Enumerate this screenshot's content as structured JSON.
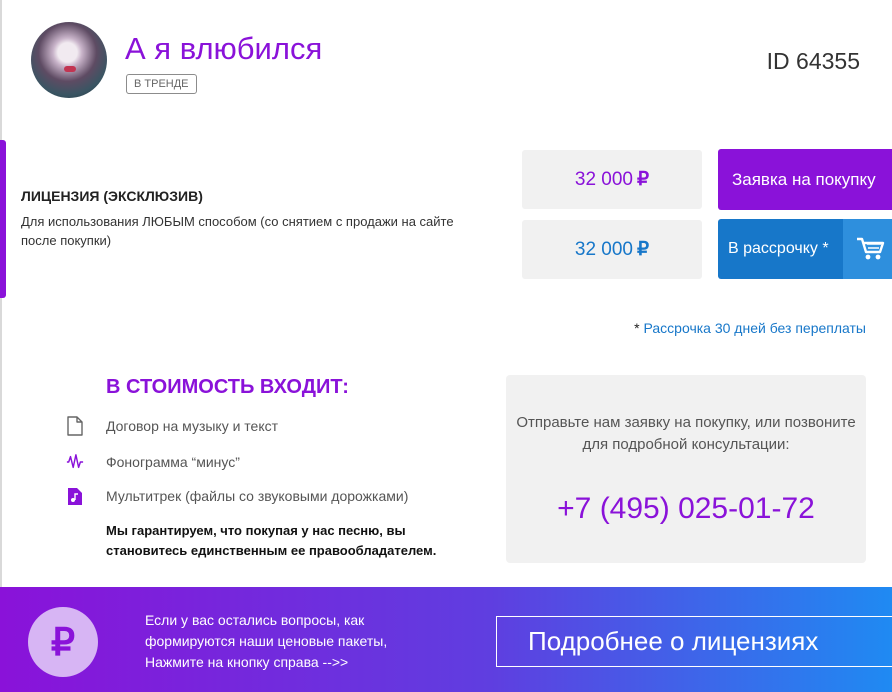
{
  "header": {
    "title": "А я влюбился",
    "badge": "В ТРЕНДЕ",
    "id_label": "ID 64355"
  },
  "license": {
    "title": "ЛИЦЕНЗИЯ (ЭКСКЛЮЗИВ)",
    "description": "Для использования ЛЮБЫМ способом (со снятием с продажи на сайте после покупки)",
    "price_full": "32 000",
    "price_installment": "32 000",
    "currency_symbol": "₽",
    "buy_button": "Заявка на покупку",
    "installment_button": "В рассрочку *",
    "installment_note_star": "*",
    "installment_note": "Рассрочка 30 дней без переплаты"
  },
  "includes": {
    "title": "В СТОИМОСТЬ ВХОДИТ:",
    "items": [
      {
        "icon": "document-icon",
        "label": "Договор на музыку и текст"
      },
      {
        "icon": "waveform-icon",
        "label": "Фонограмма “минус”"
      },
      {
        "icon": "music-file-icon",
        "label": "Мультитрек (файлы со звуковыми дорожками)"
      }
    ],
    "guarantee": "Мы гарантируем, что покупая у нас песню, вы становитесь единственным ее правообладателем."
  },
  "contact": {
    "text": "Отправьте нам заявку на покупку, или позвоните для подробной консультации:",
    "phone": "+7 (495) 025-01-72"
  },
  "footer": {
    "ruble_symbol": "₽",
    "text": "Если у вас остались вопросы, как формируются наши ценовые пакеты, Нажмите на кнопку справа -->>",
    "button": "Подробнее о лицензиях"
  },
  "colors": {
    "accent_purple": "#8a12d9",
    "accent_blue": "#1777c9",
    "panel_gray": "#f1f1f1"
  }
}
